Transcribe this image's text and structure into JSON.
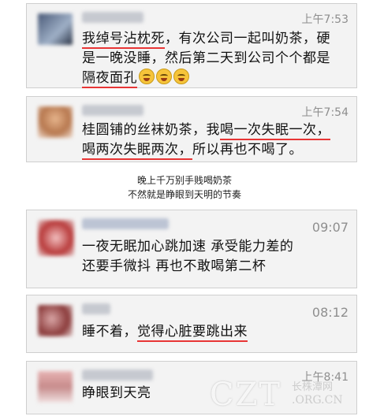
{
  "messages": [
    {
      "time": "上午7:53",
      "lines": [
        [
          {
            "t": "我绰号沾枕死",
            "hl": true
          },
          {
            "t": "，有次公司一起叫奶茶，硬"
          }
        ],
        [
          {
            "t": "是一晚没睡，然后第二天到公司个个都是"
          }
        ],
        [
          {
            "t": "隔夜面孔",
            "hl": true
          }
        ]
      ],
      "emoji_count": 3
    },
    {
      "time": "上午7:54",
      "lines": [
        [
          {
            "t": "桂圆铺的丝袜奶茶，我"
          },
          {
            "t": "喝一次失眠一次，",
            "hl": true
          }
        ],
        [
          {
            "t": "喝两次失眠两次，",
            "hl": true
          },
          {
            "t": "所以再也不喝了。"
          }
        ]
      ],
      "emoji_count": 0
    },
    {
      "time": "09:07",
      "lines": [
        [
          {
            "t": "一夜无眠加心跳加速 承受能力差的"
          }
        ],
        [
          {
            "t": "还要手微抖 再也不敢喝第二杯"
          }
        ]
      ],
      "emoji_count": 0
    },
    {
      "time": "08:12",
      "lines": [
        [
          {
            "t": "睡不着，"
          },
          {
            "t": "觉得心脏要跳出来",
            "hl": true
          }
        ]
      ],
      "emoji_count": 0
    },
    {
      "time": "上午8:41",
      "lines": [
        [
          {
            "t": "睁眼到天亮"
          }
        ]
      ],
      "emoji_count": 0
    }
  ],
  "caption": {
    "line1": "晚上千万别手贱喝奶茶",
    "line2": "不然就是睁眼到天明的节奏"
  },
  "watermark": {
    "main": "CZT",
    "sub": "长株潭网",
    "domain": ".ORG.CN"
  },
  "colors": {
    "highlight": "#e83535",
    "card_bg": "#f3f3f3",
    "time": "#8e8e8e"
  }
}
